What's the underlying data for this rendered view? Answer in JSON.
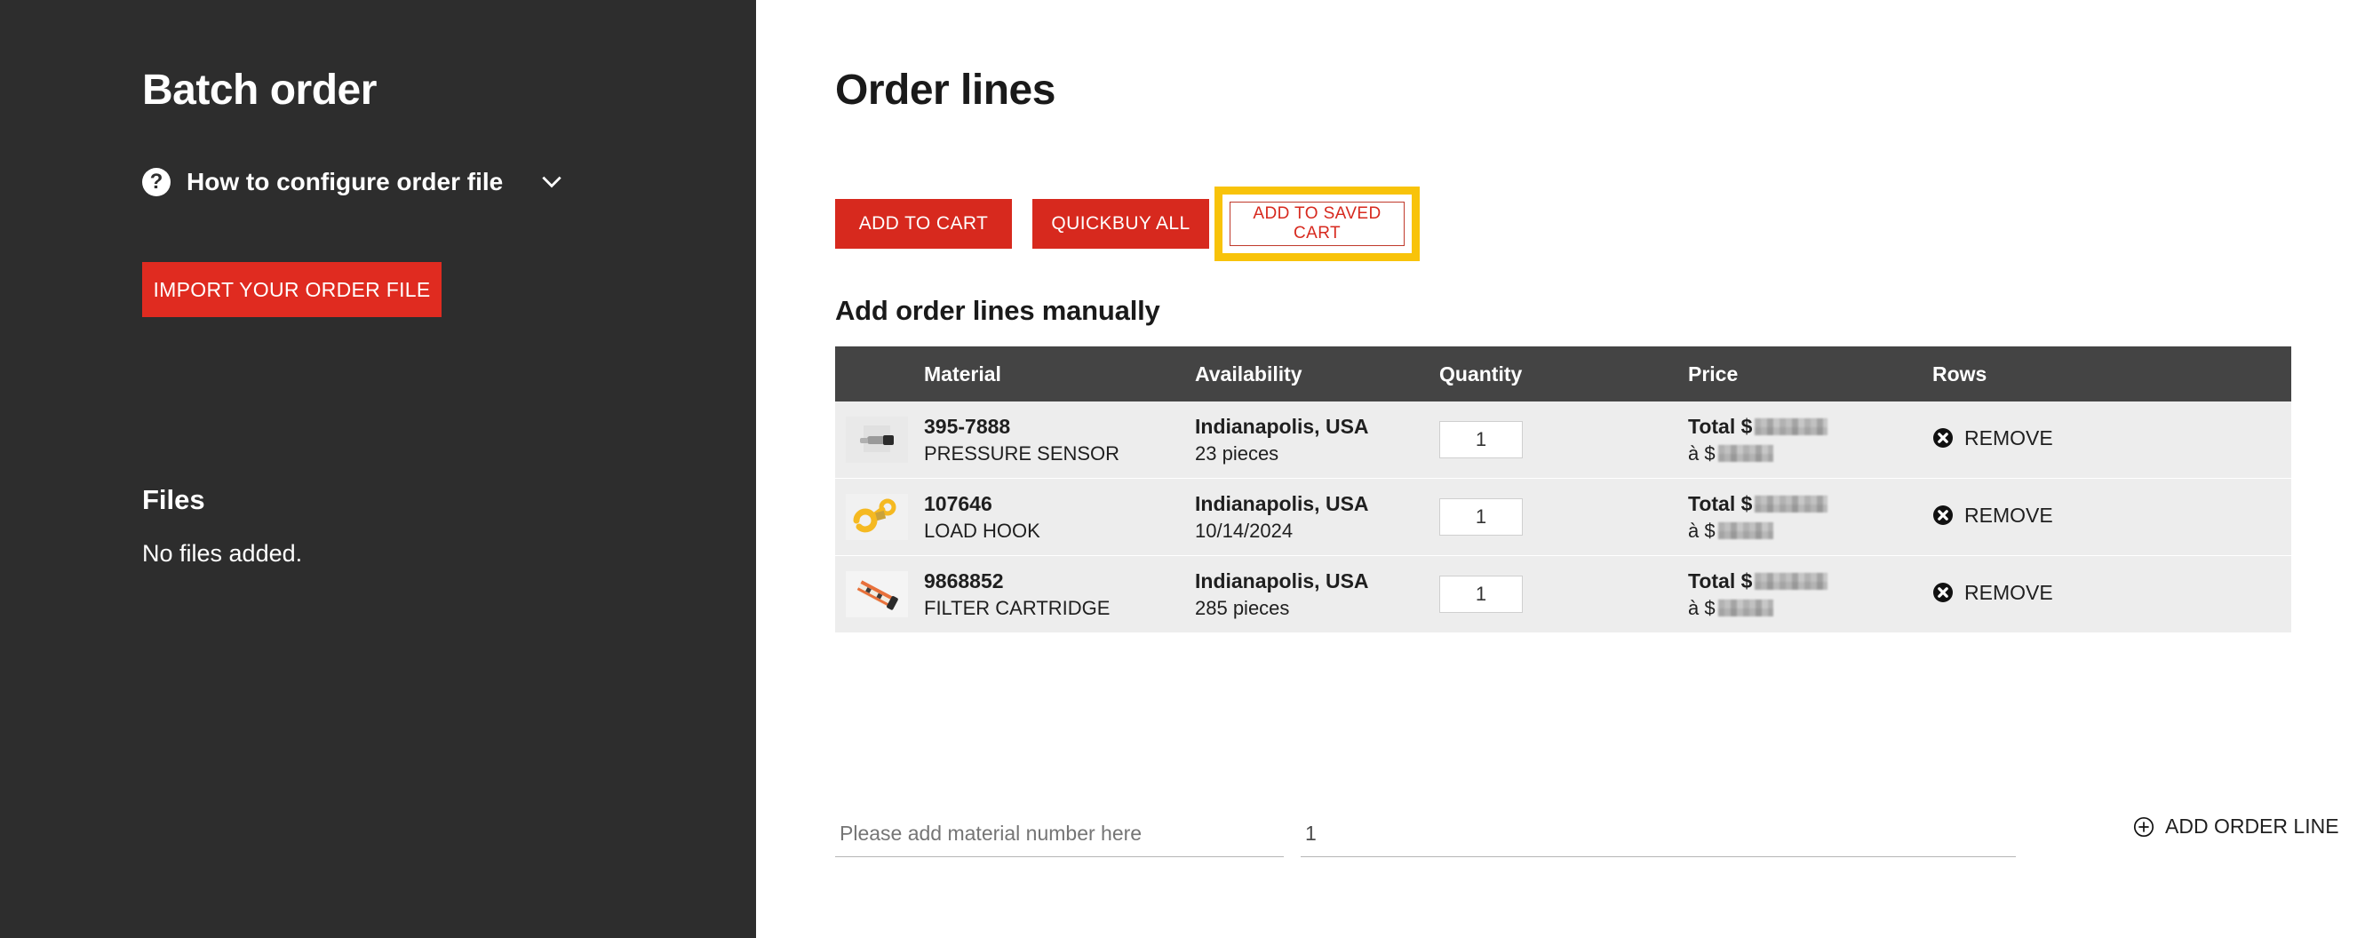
{
  "sidebar": {
    "title": "Batch order",
    "help": {
      "icon": "question-mark-circle-icon",
      "label": "How to configure order file",
      "chevron": "chevron-down-icon"
    },
    "import_button": "IMPORT YOUR ORDER FILE",
    "files_title": "Files",
    "files_empty": "No files added."
  },
  "main": {
    "title": "Order lines",
    "actions": {
      "add_to_cart": "ADD TO CART",
      "quickbuy_all": "QUICKBUY ALL",
      "add_to_saved_cart": "ADD TO SAVED CART"
    },
    "subheading": "Add order lines manually",
    "table": {
      "headers": {
        "material": "Material",
        "availability": "Availability",
        "quantity": "Quantity",
        "price": "Price",
        "rows": "Rows"
      },
      "rows": [
        {
          "image": "pressure-sensor-thumbnail",
          "material_number": "395-7888",
          "material_name": "PRESSURE SENSOR",
          "availability_location": "Indianapolis, USA",
          "availability_detail": "23 pieces",
          "quantity": "1",
          "price_total_label": "Total $",
          "price_unit_label": "à $",
          "remove_label": "REMOVE",
          "remove_icon": "close-circle-icon"
        },
        {
          "image": "load-hook-thumbnail",
          "material_number": "107646",
          "material_name": "LOAD HOOK",
          "availability_location": "Indianapolis, USA",
          "availability_detail": "10/14/2024",
          "quantity": "1",
          "price_total_label": "Total $",
          "price_unit_label": "à $",
          "remove_label": "REMOVE",
          "remove_icon": "close-circle-icon"
        },
        {
          "image": "filter-cartridge-thumbnail",
          "material_number": "9868852",
          "material_name": "FILTER CARTRIDGE",
          "availability_location": "Indianapolis, USA",
          "availability_detail": "285 pieces",
          "quantity": "1",
          "price_total_label": "Total $",
          "price_unit_label": "à $",
          "remove_label": "REMOVE",
          "remove_icon": "close-circle-icon"
        }
      ]
    },
    "add_line": {
      "material_placeholder": "Please add material number here",
      "quantity_value": "1",
      "button_label": "ADD ORDER LINE",
      "button_icon": "plus-circle-icon"
    }
  },
  "colors": {
    "sidebar_bg": "#2d2d2d",
    "brand_red": "#d7291e",
    "import_red": "#e02b20",
    "highlight_yellow": "#f8c30a",
    "table_header_bg": "#444444",
    "row_bg": "#ededed"
  }
}
